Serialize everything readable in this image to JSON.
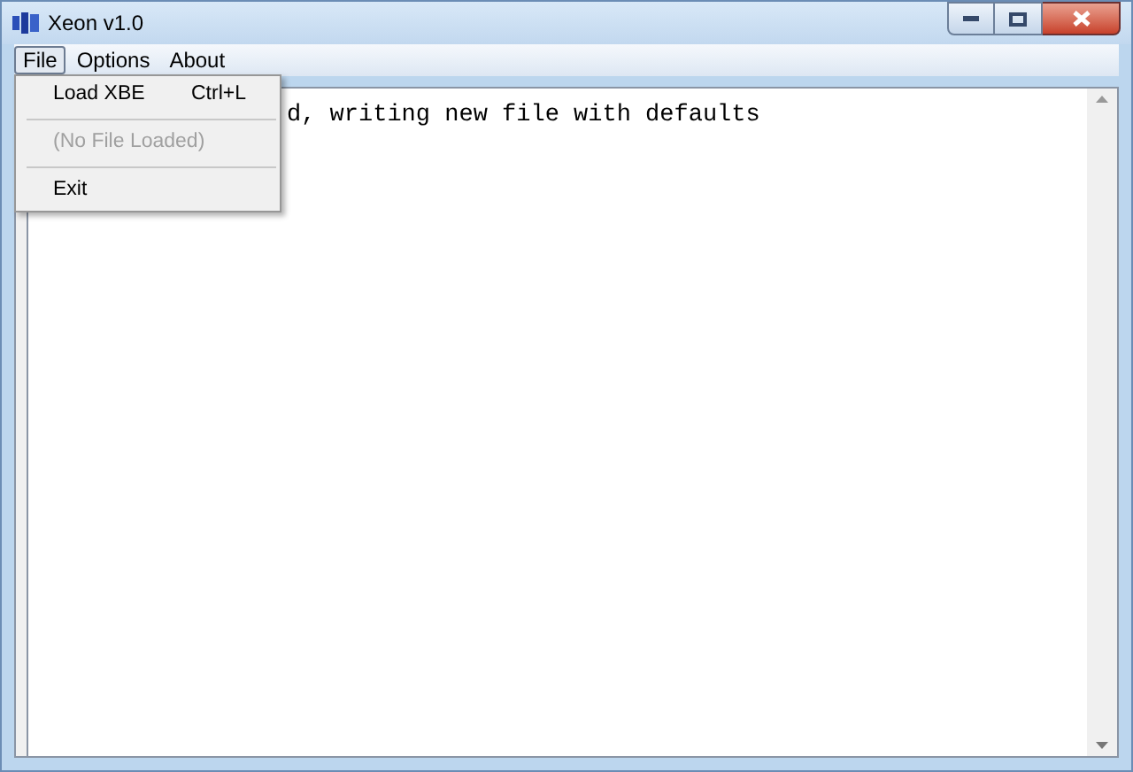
{
  "window": {
    "title": "Xeon v1.0"
  },
  "menubar": [
    {
      "label": "File",
      "selected": true
    },
    {
      "label": "Options",
      "selected": false
    },
    {
      "label": "About",
      "selected": false
    }
  ],
  "file_menu": [
    {
      "kind": "item",
      "label": "Load XBE",
      "shortcut": "Ctrl+L",
      "disabled": false
    },
    {
      "kind": "separator"
    },
    {
      "kind": "item",
      "label": "(No File Loaded)",
      "disabled": true
    },
    {
      "kind": "separator"
    },
    {
      "kind": "item",
      "label": "Exit",
      "disabled": false
    }
  ],
  "log_text": "d, writing new file with defaults"
}
